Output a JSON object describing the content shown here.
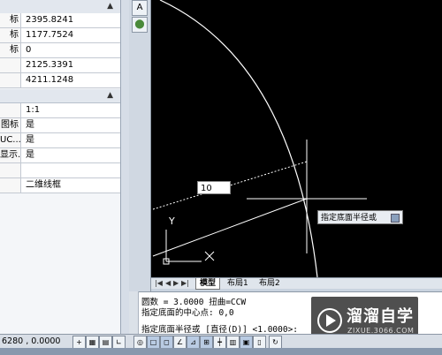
{
  "properties": {
    "geometry_rows": [
      {
        "key": "标",
        "value": "2395.8241"
      },
      {
        "key": "标",
        "value": "1177.7524"
      },
      {
        "key": "标",
        "value": "0"
      },
      {
        "key": "",
        "value": "2125.3391"
      },
      {
        "key": "",
        "value": "4211.1248"
      }
    ],
    "misc_rows": [
      {
        "key": "",
        "value": "1:1"
      },
      {
        "key": "图标",
        "value": "是"
      },
      {
        "key": "UC...",
        "value": "是"
      },
      {
        "key": "显示...",
        "value": "是"
      },
      {
        "key": "",
        "value": ""
      },
      {
        "key": "",
        "value": "二维线框"
      }
    ]
  },
  "toolbar": {
    "top_letter": "A"
  },
  "canvas": {
    "dynamic_input_value": "10",
    "tooltip_text": "指定底面半径或"
  },
  "tabs": {
    "nav_glyphs": [
      "|◀",
      "◀",
      "▶",
      "▶|"
    ],
    "items": [
      "模型",
      "布局1",
      "布局2"
    ]
  },
  "command": {
    "line1": "圆数 = 3.0000      扭曲=CCW",
    "line2": "指定底面的中心点: 0,0",
    "line3": "指定底面半径或 [直径(D)] <1.0000>:"
  },
  "status": {
    "coords": "6280 , 0.0000"
  },
  "colors": {
    "canvas_bg": "#000000",
    "crosshair": "#ffffff",
    "arc": "#ffffff"
  }
}
